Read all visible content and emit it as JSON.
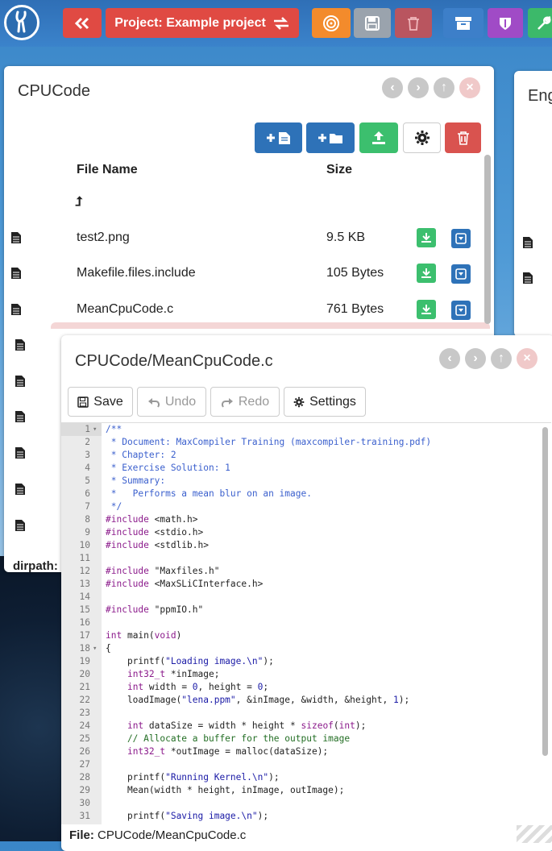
{
  "toolbar": {
    "project_label": "Project: Example project"
  },
  "files_panel": {
    "title": "CPUCode",
    "columns": {
      "name": "File Name",
      "size": "Size"
    },
    "up_symbol": "⮥",
    "files": [
      {
        "name": "test2.png",
        "size": "9.5 KB"
      },
      {
        "name": "Makefile.files.include",
        "size": "105 Bytes"
      },
      {
        "name": "MeanCpuCode.c",
        "size": "761 Bytes"
      }
    ],
    "dirpath_label": "dirpath:"
  },
  "right_panel": {
    "title": "Eng"
  },
  "editor_panel": {
    "title": "CPUCode/MeanCpuCode.c",
    "buttons": {
      "save": "Save",
      "undo": "Undo",
      "redo": "Redo",
      "settings": "Settings"
    },
    "footer_label": "File:",
    "footer_path": "CPUCode/MeanCpuCode.c",
    "lines": [
      "/**",
      " * Document: MaxCompiler Training (maxcompiler-training.pdf)",
      " * Chapter: 2",
      " * Exercise Solution: 1",
      " * Summary:",
      " *   Performs a mean blur on an image.",
      " */",
      "#include <math.h>",
      "#include <stdio.h>",
      "#include <stdlib.h>",
      "",
      "#include \"Maxfiles.h\"",
      "#include <MaxSLiCInterface.h>",
      "",
      "#include \"ppmIO.h\"",
      "",
      "int main(void)",
      "{",
      "    printf(\"Loading image.\\n\");",
      "    int32_t *inImage;",
      "    int width = 0, height = 0;",
      "    loadImage(\"lena.ppm\", &inImage, &width, &height, 1);",
      "",
      "    int dataSize = width * height * sizeof(int);",
      "    // Allocate a buffer for the output image",
      "    int32_t *outImage = malloc(dataSize);",
      "",
      "    printf(\"Running Kernel.\\n\");",
      "    Mean(width * height, inImage, outImage);",
      "",
      "    printf(\"Saving image.\\n\");"
    ]
  },
  "colors": {
    "red": "#e04a43",
    "orange": "#f38b2c",
    "green": "#3cbf6e",
    "blue": "#2e72b8",
    "purple": "#a04bc6"
  }
}
